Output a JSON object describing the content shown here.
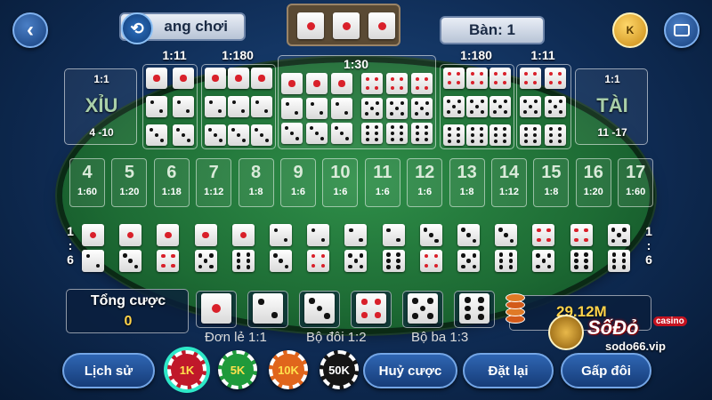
{
  "header": {
    "back_icon": "chevron-left-icon",
    "history_icon": "history-icon",
    "game_tab": "ang chơi",
    "table_label": "Bàn: 1",
    "coin_icon": "K",
    "chat_icon": "chat-icon",
    "result_dice": [
      1,
      1,
      1
    ]
  },
  "bets": {
    "xiu": {
      "odds": "1:1",
      "label": "XỈU",
      "range": "4 -10"
    },
    "tai": {
      "odds": "1:1",
      "label": "TÀI",
      "range": "11 -17"
    },
    "pair_odds_left": "1:11",
    "triple_odds_left": "1:180",
    "any_triple_odds": "1:30",
    "triple_odds_right": "1:180",
    "pair_odds_right": "1:11",
    "sums": [
      {
        "n": "4",
        "o": "1:60"
      },
      {
        "n": "5",
        "o": "1:20"
      },
      {
        "n": "6",
        "o": "1:18"
      },
      {
        "n": "7",
        "o": "1:12"
      },
      {
        "n": "8",
        "o": "1:8"
      },
      {
        "n": "9",
        "o": "1:6"
      },
      {
        "n": "10",
        "o": "1:6"
      },
      {
        "n": "11",
        "o": "1:6"
      },
      {
        "n": "12",
        "o": "1:6"
      },
      {
        "n": "13",
        "o": "1:8"
      },
      {
        "n": "14",
        "o": "1:12"
      },
      {
        "n": "15",
        "o": "1:8"
      },
      {
        "n": "16",
        "o": "1:20"
      },
      {
        "n": "17",
        "o": "1:60"
      }
    ],
    "combo_side_left": "1\n:\n6",
    "combo_side_right": "1\n:\n6",
    "combos": [
      [
        1,
        2
      ],
      [
        1,
        3
      ],
      [
        1,
        4
      ],
      [
        1,
        5
      ],
      [
        1,
        6
      ],
      [
        2,
        3
      ],
      [
        2,
        4
      ],
      [
        2,
        5
      ],
      [
        2,
        6
      ],
      [
        3,
        4
      ],
      [
        3,
        5
      ],
      [
        3,
        6
      ],
      [
        4,
        5
      ],
      [
        4,
        6
      ],
      [
        5,
        6
      ]
    ]
  },
  "footer": {
    "total_bet_label": "Tổng cược",
    "total_bet_value": "0",
    "single_dice": [
      1,
      2,
      3,
      4,
      5,
      6
    ],
    "balance": "29.12M",
    "odds_single": "Đơn lẻ 1:1",
    "odds_pair": "Bộ đôi 1:2",
    "odds_triple": "Bộ ba 1:3",
    "history_btn": "Lịch sử",
    "chips": [
      {
        "label": "1K",
        "color": "#c0182a"
      },
      {
        "label": "5K",
        "color": "#1f9a3b"
      },
      {
        "label": "10K",
        "color": "#e0651c"
      },
      {
        "label": "50K",
        "color": "#151515"
      }
    ],
    "cancel_btn": "Huỷ cược",
    "reset_btn": "Đặt lại",
    "double_btn": "Gấp đôi"
  },
  "watermark": {
    "brand": "SốĐỏ",
    "casino": "casino",
    "url": "sodo66.vip"
  }
}
